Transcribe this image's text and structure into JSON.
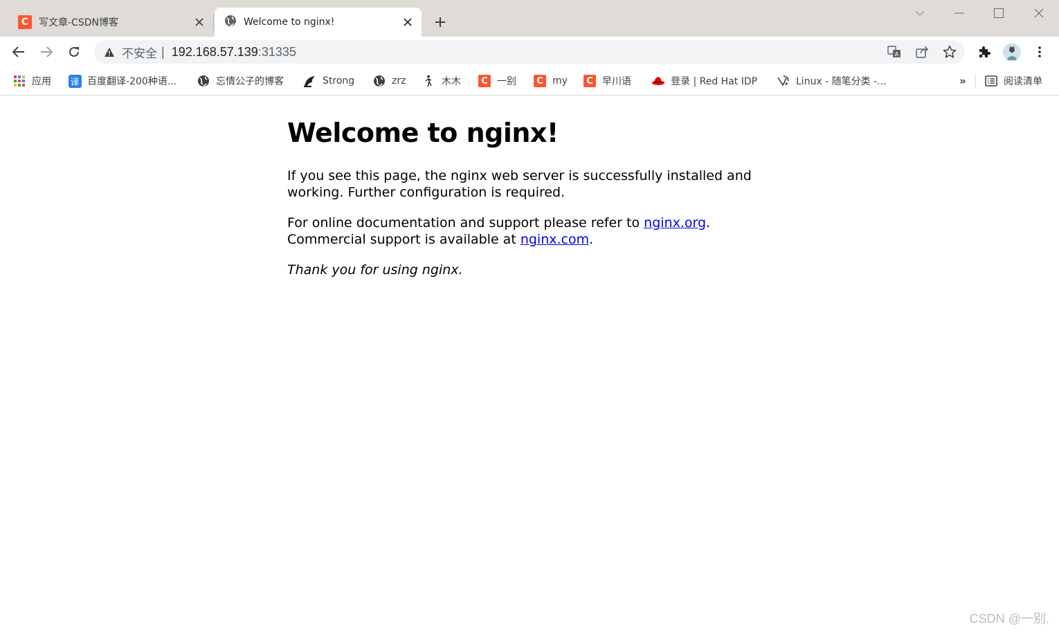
{
  "tabs": [
    {
      "title": "写文章-CSDN博客",
      "favicon": "csdn-c-icon",
      "active": false
    },
    {
      "title": "Welcome to nginx!",
      "favicon": "globe-icon",
      "active": true
    }
  ],
  "window_controls": {
    "dropdown": "chevron-down-icon",
    "minimize": "minimize-icon",
    "maximize": "maximize-icon",
    "close": "close-icon"
  },
  "toolbar": {
    "back": "back-arrow-icon",
    "forward": "forward-arrow-icon",
    "reload": "reload-icon",
    "security_label": "不安全",
    "security_separator": "|",
    "url_host": "192.168.57.139",
    "url_port": ":31335",
    "extensions": "puzzle-icon",
    "menu": "kebab-menu-icon"
  },
  "bookmarks": {
    "items": [
      {
        "label": "应用",
        "icon": "apps-grid-icon"
      },
      {
        "label": "百度翻译-200种语...",
        "icon": "translate-icon"
      },
      {
        "label": "忘情公子的博客",
        "icon": "globe-icon"
      },
      {
        "label": "Strong",
        "icon": "strong-logo-icon"
      },
      {
        "label": "zrz",
        "icon": "globe-icon"
      },
      {
        "label": "木木",
        "icon": "figure-icon"
      },
      {
        "label": "一别",
        "icon": "csdn-c-icon"
      },
      {
        "label": "my",
        "icon": "csdn-c-icon"
      },
      {
        "label": "早川语",
        "icon": "csdn-c-icon"
      },
      {
        "label": "登录 | Red Hat IDP",
        "icon": "redhat-icon"
      },
      {
        "label": "Linux - 随笔分类 -...",
        "icon": "cnblogs-icon"
      }
    ],
    "more": "»",
    "reading_list": "阅读清单"
  },
  "page": {
    "heading": "Welcome to nginx!",
    "para1": "If you see this page, the nginx web server is successfully installed and working. Further configuration is required.",
    "para2_prefix": "For online documentation and support please refer to ",
    "link_org": "nginx.org",
    "para2_mid": ".",
    "para2_line2_prefix": "Commercial support is available at ",
    "link_com": "nginx.com",
    "para2_end": ".",
    "thanks": "Thank you for using nginx."
  },
  "watermark": "CSDN @一别.",
  "colors": {
    "tabstrip": "#dfdbd7",
    "csdn_brand": "#fc5531",
    "link": "#0000ee",
    "omnibox": "#f1f3f4"
  }
}
